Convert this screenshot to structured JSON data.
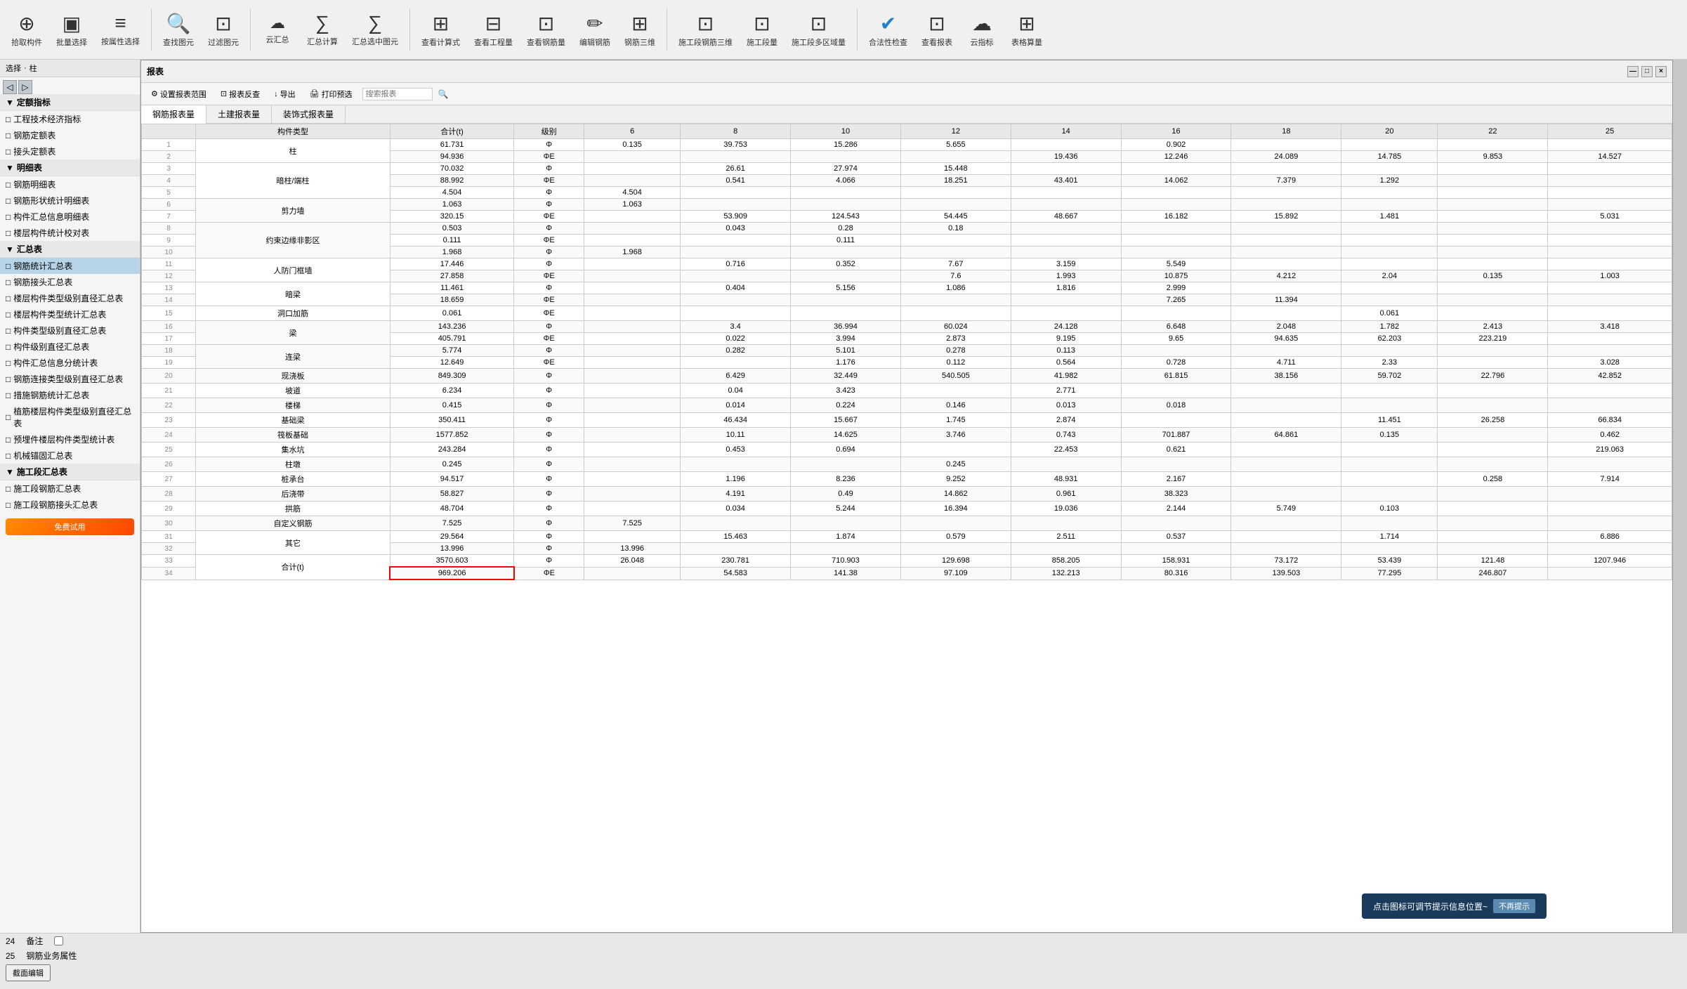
{
  "toolbar": {
    "title": "报表",
    "buttons": [
      {
        "label": "拾取构件",
        "icon": "⊕"
      },
      {
        "label": "批量选择",
        "icon": "▣"
      },
      {
        "label": "按属性选择",
        "icon": "≡"
      },
      {
        "label": "查找图元",
        "icon": "🔍"
      },
      {
        "label": "过滤图元",
        "icon": "⊡"
      },
      {
        "label": "云汇总",
        "icon": "∑"
      },
      {
        "label": "汇总计算",
        "icon": "∑"
      },
      {
        "label": "汇总选中图元",
        "icon": "∑"
      },
      {
        "label": "查看计算式",
        "icon": "⊞"
      },
      {
        "label": "查看工程量",
        "icon": "⊟"
      },
      {
        "label": "查看钢筋量",
        "icon": "⊡"
      },
      {
        "label": "编辑钢筋",
        "icon": "✏"
      },
      {
        "label": "钢筋三维",
        "icon": "⊡"
      },
      {
        "label": "施工段钢筋三维",
        "icon": "⊡"
      },
      {
        "label": "施工段量",
        "icon": "⊡"
      },
      {
        "label": "施工段多区域量",
        "icon": "⊡"
      },
      {
        "label": "合法性检查",
        "icon": "✔"
      },
      {
        "label": "查看报表",
        "icon": "⊡"
      },
      {
        "label": "云指标",
        "icon": "☁"
      },
      {
        "label": "表格算量",
        "icon": "⊞"
      }
    ]
  },
  "window": {
    "title": "报表",
    "close": "×",
    "maximize": "□",
    "minimize": "—"
  },
  "report_toolbar": {
    "settings": "设置报表范围",
    "reverse": "报表反查",
    "export": "导出",
    "print": "打印预选",
    "search_placeholder": "搜索报表"
  },
  "tabs": [
    "钢筋报表量",
    "土建报表量",
    "装饰式报表量"
  ],
  "active_tab": 0,
  "tree": {
    "sections": [
      {
        "name": "定额指标",
        "items": [
          "工程技术经济指标",
          "钢筋定额表",
          "接头定额表"
        ]
      },
      {
        "name": "明细表",
        "items": [
          "钢筋明细表",
          "钢筋形状统计明细表",
          "构件汇总信息明细表",
          "楼层构件统计校对表"
        ]
      },
      {
        "name": "汇总表",
        "items": [
          "钢筋统计汇总表",
          "钢筋接头汇总表",
          "楼层构件类型级别直径汇总表",
          "楼层构件类型统计汇总表",
          "构件类型级别直径汇总表",
          "构件级别直径汇总表",
          "构件汇总信息分统计表",
          "钢筋连接类型级别直径汇总表",
          "措施钢筋统计汇总表",
          "植筋楼层构件类型级别直径汇总表",
          "预埋件楼层构件类型统计表",
          "机械锚固汇总表"
        ]
      },
      {
        "name": "施工段汇总表",
        "items": [
          "施工段钢筋汇总表",
          "施工段钢筋接头汇总表"
        ]
      }
    ]
  },
  "left_panel_header": {
    "label": "选择",
    "type": "柱"
  },
  "table": {
    "columns": [
      "构件类型",
      "合计(t)",
      "级别",
      "6",
      "8",
      "10",
      "12",
      "14",
      "16",
      "18",
      "20",
      "22",
      "25"
    ],
    "rows": [
      {
        "no": 1,
        "type": "柱",
        "total": "61.731",
        "grade": "Φ",
        "c6": "0.135",
        "c8": "39.753",
        "c10": "15.286",
        "c12": "5.655",
        "c14": "",
        "c16": "0.902",
        "c18": "",
        "c20": "",
        "c22": "",
        "c25": ""
      },
      {
        "no": 2,
        "type": "",
        "total": "94.936",
        "grade": "ΦE",
        "c6": "",
        "c8": "",
        "c10": "",
        "c12": "",
        "c14": "19.436",
        "c16": "12.246",
        "c18": "24.089",
        "c20": "14.785",
        "c22": "9.853",
        "c25": "14.527"
      },
      {
        "no": 3,
        "type": "暗柱/端柱",
        "total": "70.032",
        "grade": "Φ",
        "c6": "",
        "c8": "26.61",
        "c10": "27.974",
        "c12": "15.448",
        "c14": "",
        "c16": "",
        "c18": "",
        "c20": "",
        "c22": "",
        "c25": ""
      },
      {
        "no": 4,
        "type": "",
        "total": "88.992",
        "grade": "ΦE",
        "c6": "",
        "c8": "0.541",
        "c10": "4.066",
        "c12": "18.251",
        "c14": "43.401",
        "c16": "14.062",
        "c18": "7.379",
        "c20": "1.292",
        "c22": "",
        "c25": ""
      },
      {
        "no": 5,
        "type": "",
        "total": "4.504",
        "grade": "Φ",
        "c6": "4.504",
        "c8": "",
        "c10": "",
        "c12": "",
        "c14": "",
        "c16": "",
        "c18": "",
        "c20": "",
        "c22": "",
        "c25": ""
      },
      {
        "no": 6,
        "type": "剪力墙",
        "total": "1.063",
        "grade": "Φ",
        "c6": "1.063",
        "c8": "",
        "c10": "",
        "c12": "",
        "c14": "",
        "c16": "",
        "c18": "",
        "c20": "",
        "c22": "",
        "c25": ""
      },
      {
        "no": 7,
        "type": "",
        "total": "320.15",
        "grade": "ΦE",
        "c6": "",
        "c8": "53.909",
        "c10": "124.543",
        "c12": "54.445",
        "c14": "48.667",
        "c16": "16.182",
        "c18": "15.892",
        "c20": "1.481",
        "c22": "",
        "c25": "5.031"
      },
      {
        "no": 8,
        "type": "约束边缘非影区",
        "total": "0.503",
        "grade": "Φ",
        "c6": "",
        "c8": "0.043",
        "c10": "0.28",
        "c12": "0.18",
        "c14": "",
        "c16": "",
        "c18": "",
        "c20": "",
        "c22": "",
        "c25": ""
      },
      {
        "no": 9,
        "type": "",
        "total": "0.111",
        "grade": "ΦE",
        "c6": "",
        "c8": "",
        "c10": "0.111",
        "c12": "",
        "c14": "",
        "c16": "",
        "c18": "",
        "c20": "",
        "c22": "",
        "c25": ""
      },
      {
        "no": 10,
        "type": "",
        "total": "1.968",
        "grade": "Φ",
        "c6": "1.968",
        "c8": "",
        "c10": "",
        "c12": "",
        "c14": "",
        "c16": "",
        "c18": "",
        "c20": "",
        "c22": "",
        "c25": ""
      },
      {
        "no": 11,
        "type": "人防门框墙",
        "total": "17.446",
        "grade": "Φ",
        "c6": "",
        "c8": "0.716",
        "c10": "0.352",
        "c12": "7.67",
        "c14": "3.159",
        "c16": "5.549",
        "c18": "",
        "c20": "",
        "c22": "",
        "c25": ""
      },
      {
        "no": 12,
        "type": "",
        "total": "27.858",
        "grade": "ΦE",
        "c6": "",
        "c8": "",
        "c10": "",
        "c12": "7.6",
        "c14": "1.993",
        "c16": "10.875",
        "c18": "4.212",
        "c20": "2.04",
        "c22": "0.135",
        "c25": "1.003"
      },
      {
        "no": 13,
        "type": "暗梁",
        "total": "11.461",
        "grade": "Φ",
        "c6": "",
        "c8": "0.404",
        "c10": "5.156",
        "c12": "1.086",
        "c14": "1.816",
        "c16": "2.999",
        "c18": "",
        "c20": "",
        "c22": "",
        "c25": ""
      },
      {
        "no": 14,
        "type": "",
        "total": "18.659",
        "grade": "ΦE",
        "c6": "",
        "c8": "",
        "c10": "",
        "c12": "",
        "c14": "",
        "c16": "7.265",
        "c18": "11.394",
        "c20": "",
        "c22": "",
        "c25": ""
      },
      {
        "no": 15,
        "type": "洞口加筋",
        "total": "0.061",
        "grade": "ΦE",
        "c6": "",
        "c8": "",
        "c10": "",
        "c12": "",
        "c14": "",
        "c16": "",
        "c18": "",
        "c20": "0.061",
        "c22": "",
        "c25": ""
      },
      {
        "no": 16,
        "type": "梁",
        "total": "143.236",
        "grade": "Φ",
        "c6": "",
        "c8": "3.4",
        "c10": "36.994",
        "c12": "60.024",
        "c14": "24.128",
        "c16": "6.648",
        "c18": "2.048",
        "c20": "1.782",
        "c22": "2.413",
        "c25": "3.418"
      },
      {
        "no": 17,
        "type": "",
        "total": "405.791",
        "grade": "ΦE",
        "c6": "",
        "c8": "0.022",
        "c10": "3.994",
        "c12": "2.873",
        "c14": "9.195",
        "c16": "9.65",
        "c18": "94.635",
        "c20": "62.203",
        "c22": "223.219",
        "c25": ""
      },
      {
        "no": 18,
        "type": "连梁",
        "total": "5.774",
        "grade": "Φ",
        "c6": "",
        "c8": "0.282",
        "c10": "5.101",
        "c12": "0.278",
        "c14": "0.113",
        "c16": "",
        "c18": "",
        "c20": "",
        "c22": "",
        "c25": ""
      },
      {
        "no": 19,
        "type": "",
        "total": "12.649",
        "grade": "ΦE",
        "c6": "",
        "c8": "",
        "c10": "1.176",
        "c12": "0.112",
        "c14": "0.564",
        "c16": "0.728",
        "c18": "4.711",
        "c20": "2.33",
        "c22": "",
        "c25": "3.028"
      },
      {
        "no": 20,
        "type": "现浇板",
        "total": "849.309",
        "grade": "Φ",
        "c6": "",
        "c8": "6.429",
        "c10": "32.449",
        "c12": "540.505",
        "c14": "41.982",
        "c16": "61.815",
        "c18": "38.156",
        "c20": "59.702",
        "c22": "22.796",
        "c25": "42.852"
      },
      {
        "no": 21,
        "type": "坡道",
        "total": "6.234",
        "grade": "Φ",
        "c6": "",
        "c8": "0.04",
        "c10": "3.423",
        "c12": "",
        "c14": "2.771",
        "c16": "",
        "c18": "",
        "c20": "",
        "c22": "",
        "c25": ""
      },
      {
        "no": 22,
        "type": "楼梯",
        "total": "0.415",
        "grade": "Φ",
        "c6": "",
        "c8": "0.014",
        "c10": "0.224",
        "c12": "0.146",
        "c14": "0.013",
        "c16": "0.018",
        "c18": "",
        "c20": "",
        "c22": "",
        "c25": ""
      },
      {
        "no": 23,
        "type": "基础梁",
        "total": "350.411",
        "grade": "Φ",
        "c6": "",
        "c8": "46.434",
        "c10": "15.667",
        "c12": "1.745",
        "c14": "2.874",
        "c16": "",
        "c18": "",
        "c20": "11.451",
        "c22": "26.258",
        "c25": "66.834"
      },
      {
        "no": 24,
        "type": "筏板基础",
        "total": "1577.852",
        "grade": "Φ",
        "c6": "",
        "c8": "10.11",
        "c10": "14.625",
        "c12": "3.746",
        "c14": "0.743",
        "c16": "701.887",
        "c18": "64.861",
        "c20": "0.135",
        "c22": "",
        "c25": "0.462"
      },
      {
        "no": 25,
        "type": "集水坑",
        "total": "243.284",
        "grade": "Φ",
        "c6": "",
        "c8": "0.453",
        "c10": "0.694",
        "c12": "",
        "c14": "22.453",
        "c16": "0.621",
        "c18": "",
        "c20": "",
        "c22": "",
        "c25": "219.063"
      },
      {
        "no": 26,
        "type": "柱墩",
        "total": "0.245",
        "grade": "Φ",
        "c6": "",
        "c8": "",
        "c10": "",
        "c12": "0.245",
        "c14": "",
        "c16": "",
        "c18": "",
        "c20": "",
        "c22": "",
        "c25": ""
      },
      {
        "no": 27,
        "type": "桩承台",
        "total": "94.517",
        "grade": "Φ",
        "c6": "",
        "c8": "1.196",
        "c10": "8.236",
        "c12": "9.252",
        "c14": "48.931",
        "c16": "2.167",
        "c18": "",
        "c20": "",
        "c22": "0.258",
        "c25": "7.914"
      },
      {
        "no": 28,
        "type": "后浇带",
        "total": "58.827",
        "grade": "Φ",
        "c6": "",
        "c8": "4.191",
        "c10": "0.49",
        "c12": "14.862",
        "c14": "0.961",
        "c16": "38.323",
        "c18": "",
        "c20": "",
        "c22": "",
        "c25": ""
      },
      {
        "no": 29,
        "type": "拱筋",
        "total": "48.704",
        "grade": "Φ",
        "c6": "",
        "c8": "0.034",
        "c10": "5.244",
        "c12": "16.394",
        "c14": "19.036",
        "c16": "2.144",
        "c18": "5.749",
        "c20": "0.103",
        "c22": "",
        "c25": ""
      },
      {
        "no": 30,
        "type": "自定义钢筋",
        "total": "7.525",
        "grade": "Φ",
        "c6": "7.525",
        "c8": "",
        "c10": "",
        "c12": "",
        "c14": "",
        "c16": "",
        "c18": "",
        "c20": "",
        "c22": "",
        "c25": ""
      },
      {
        "no": 31,
        "type": "其它",
        "total": "29.564",
        "grade": "Φ",
        "c6": "",
        "c8": "15.463",
        "c10": "1.874",
        "c12": "0.579",
        "c14": "2.511",
        "c16": "0.537",
        "c18": "",
        "c20": "1.714",
        "c22": "",
        "c25": "6.886"
      },
      {
        "no": 32,
        "type": "",
        "total": "13.996",
        "grade": "Φ",
        "c6": "13.996",
        "c8": "",
        "c10": "",
        "c12": "",
        "c14": "",
        "c16": "",
        "c18": "",
        "c20": "",
        "c22": "",
        "c25": ""
      },
      {
        "no": 33,
        "type": "合计(t)",
        "total": "3570.603",
        "grade": "Φ",
        "c6": "26.048",
        "c8": "230.781",
        "c10": "710.903",
        "c12": "129.698",
        "c14": "858.205",
        "c16": "158.931",
        "c18": "73.172",
        "c20": "53.439",
        "c22": "121.48",
        "c25": "1207.946"
      },
      {
        "no": 34,
        "type": "",
        "total": "969.206",
        "grade": "ΦE",
        "c6": "",
        "c8": "54.583",
        "c10": "141.38",
        "c12": "97.109",
        "c14": "132.213",
        "c16": "80.316",
        "c18": "139.503",
        "c20": "77.295",
        "c22": "246.807",
        "c25": ""
      }
    ]
  },
  "bottom": {
    "row1_label1": "24",
    "row1_val1": "备注",
    "row2_label1": "25",
    "row2_val1": "钢筋业务属性",
    "row3_val1": "截面编辑"
  },
  "toast": {
    "text": "点击图标可调节提示信息位置~",
    "close_label": "不再提示"
  }
}
